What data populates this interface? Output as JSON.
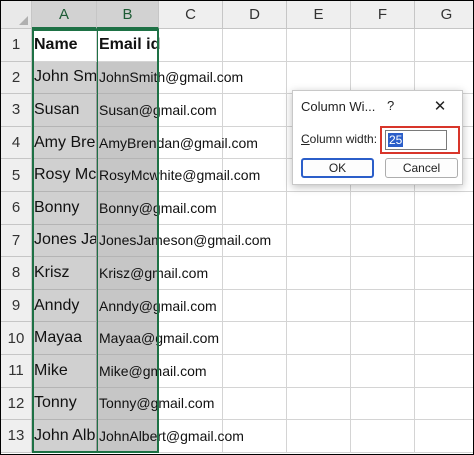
{
  "columns": [
    "A",
    "B",
    "C",
    "D",
    "E",
    "F",
    "G"
  ],
  "rows": [
    {
      "num": "1",
      "a": "Name",
      "b": "Email id"
    },
    {
      "num": "2",
      "a": "John Smith",
      "b": "JohnSmith@gmail.com"
    },
    {
      "num": "3",
      "a": "Susan",
      "b": "Susan@gmail.com"
    },
    {
      "num": "4",
      "a": "Amy Brendan",
      "b": "AmyBrendan@gmail.com"
    },
    {
      "num": "5",
      "a": "Rosy Mcwhite",
      "b": "RosyMcwhite@gmail.com"
    },
    {
      "num": "6",
      "a": "Bonny",
      "b": "Bonny@gmail.com"
    },
    {
      "num": "7",
      "a": "Jones Jameson",
      "b": "JonesJameson@gmail.com"
    },
    {
      "num": "8",
      "a": "Krisz",
      "b": "Krisz@gmail.com"
    },
    {
      "num": "9",
      "a": "Anndy",
      "b": "Anndy@gmail.com"
    },
    {
      "num": "10",
      "a": "Mayaa",
      "b": "Mayaa@gmail.com"
    },
    {
      "num": "11",
      "a": "Mike",
      "b": "Mike@gmail.com"
    },
    {
      "num": "12",
      "a": "Tonny",
      "b": "Tonny@gmail.com"
    },
    {
      "num": "13",
      "a": "John Albert",
      "b": "JohnAlbert@gmail.com"
    }
  ],
  "dialog": {
    "title": "Column Wi...",
    "help": "?",
    "close": "✕",
    "label_prefix": "C",
    "label_rest": "olumn width:",
    "input_value": "25",
    "ok_label": "OK",
    "cancel_label": "Cancel"
  },
  "colors": {
    "selection_border": "#1e7145",
    "highlight_box": "#d8352a",
    "selected_text_bg": "#2b5ec9"
  }
}
